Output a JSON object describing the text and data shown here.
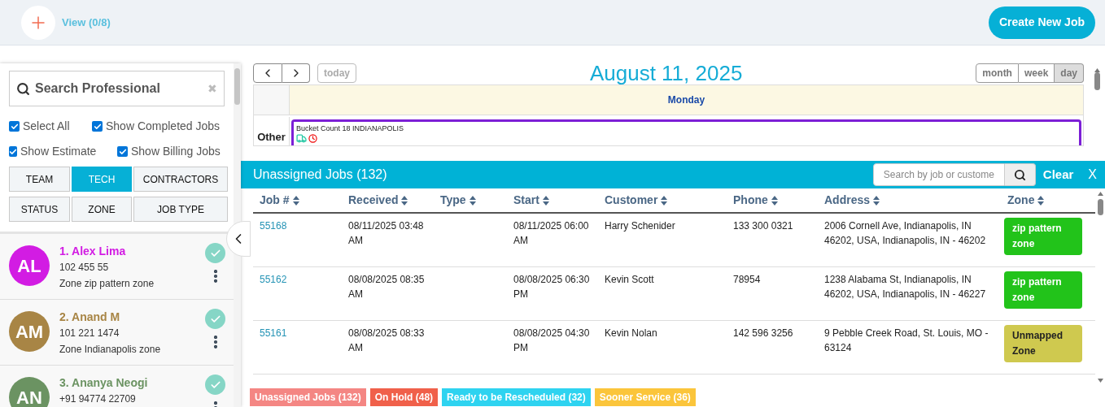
{
  "header": {
    "view_label": "View (0/8)",
    "create_button": "Create New Job"
  },
  "sidebar": {
    "search": {
      "placeholder": "Search Professional",
      "clear": "✖"
    },
    "options": [
      {
        "label": "Select All",
        "checked": true
      },
      {
        "label": "Show Completed Jobs",
        "checked": true
      },
      {
        "label": "Show Estimate",
        "checked": true
      },
      {
        "label": "Show Billing Jobs",
        "checked": true
      }
    ],
    "filter_tabs": [
      {
        "label": "TEAM",
        "selected": false
      },
      {
        "label": "TECH",
        "selected": true
      },
      {
        "label": "CONTRACTORS",
        "selected": false
      },
      {
        "label": "STATUS",
        "selected": false
      },
      {
        "label": "ZONE",
        "selected": false
      },
      {
        "label": "JOB TYPE",
        "selected": false
      }
    ],
    "professionals": [
      {
        "initials": "AL",
        "name": "1. Alex Lima",
        "phone": "102 455 55",
        "zone": "Zone zip pattern zone",
        "color": "#d21ce3",
        "active": true
      },
      {
        "initials": "AM",
        "name": "2. Anand M",
        "phone": "101 221 1474",
        "zone": "Zone Indianapolis zone",
        "color": "#a88545",
        "active": true
      },
      {
        "initials": "AN",
        "name": "3. Ananya Neogi",
        "phone": "+91 94774 22709",
        "color": "#6b9362",
        "active": true
      }
    ]
  },
  "calendar": {
    "today": "today",
    "title": "August 11, 2025",
    "views": [
      {
        "label": "month",
        "selected": false
      },
      {
        "label": "week",
        "selected": false
      },
      {
        "label": "day",
        "selected": true
      }
    ],
    "day_header": "Monday",
    "row_label": "Other",
    "event": {
      "title": "Bucket Count 18 INDIANAPOLIS"
    }
  },
  "unassigned": {
    "title": "Unassigned Jobs (132)",
    "search": {
      "placeholder": "Search by job or custome"
    },
    "clear": "Clear",
    "close": "X",
    "columns": [
      "Job #",
      "Received",
      "Type",
      "Start",
      "Customer",
      "Phone",
      "Address",
      "Zone"
    ],
    "rows": [
      {
        "job": "55168",
        "received": "08/11/2025 03:48 AM",
        "start": "08/11/2025 06:00 AM",
        "customer": "Harry Schenider",
        "phone": "133 300 0321",
        "address": "2006 Cornell Ave, Indianapolis, IN 46202, USA, Indianapolis, IN - 46202",
        "zone": "zip pattern zone",
        "color": "#22c31a"
      },
      {
        "job": "55162",
        "received": "08/08/2025 08:35 AM",
        "start": "08/08/2025 06:30 PM",
        "customer": "Kevin Scott",
        "phone": "78954",
        "address": "1238 Alabama St, Indianapolis, IN 46202, USA, Indianapolis, IN - 46227",
        "zone": "zip pattern zone",
        "color": "#22c31a"
      },
      {
        "job": "55161",
        "received": "08/08/2025 08:33 AM",
        "start": "08/08/2025 04:30 PM",
        "customer": "Kevin Nolan",
        "phone": "142 596 3256",
        "address": "9 Pebble Creek Road, St. Louis, MO - 63124",
        "zone": "Unmapped Zone",
        "color": "#cfc94f"
      }
    ],
    "status_tabs": [
      {
        "label": "Unassigned Jobs (132)",
        "color": "#f48683"
      },
      {
        "label": "On Hold (48)",
        "color": "#f0604a"
      },
      {
        "label": "Ready to be Rescheduled (32)",
        "color": "#2ed3f0"
      },
      {
        "label": "Sooner Service (36)",
        "color": "#fbc53b"
      }
    ]
  }
}
